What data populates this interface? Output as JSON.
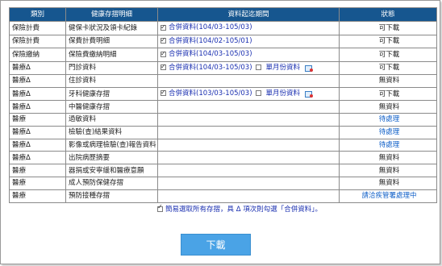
{
  "headers": {
    "category": "類別",
    "detail": "健康存摺明細",
    "period": "資料起迄期間",
    "status": "狀態"
  },
  "rows": [
    {
      "category": "保險計費",
      "detail": "健保卡狀況及領卡紀錄",
      "range": "合併資料(104/03-105/03)",
      "monthly": "",
      "status": "可下載",
      "status_link": false
    },
    {
      "category": "保險計費",
      "detail": "保費計費明細",
      "range": "合併資料(104/02-105/01)",
      "monthly": "",
      "status": "可下載",
      "status_link": false
    },
    {
      "category": "保險繳納",
      "detail": "保險費繳納明細",
      "range": "合併資料(104/03-105/03)",
      "monthly": "",
      "status": "可下載",
      "status_link": false
    },
    {
      "category": "醫療Δ",
      "detail": "門診資料",
      "range": "合併資料(104/03-105/03)",
      "monthly": "單月份資料",
      "status": "可下載",
      "status_link": false
    },
    {
      "category": "醫療Δ",
      "detail": "住診資料",
      "range": "",
      "monthly": "",
      "status": "無資料",
      "status_link": false
    },
    {
      "category": "醫療Δ",
      "detail": "牙科健康存摺",
      "range": "合併資料(103/03-105/03)",
      "monthly": "單月份資料",
      "status": "可下載",
      "status_link": false
    },
    {
      "category": "醫療Δ",
      "detail": "中醫健康存摺",
      "range": "",
      "monthly": "",
      "status": "無資料",
      "status_link": false
    },
    {
      "category": "醫療",
      "detail": "過敏資料",
      "range": "",
      "monthly": "",
      "status": "待處理",
      "status_link": true
    },
    {
      "category": "醫療Δ",
      "detail": "檢驗(查)結果資料",
      "range": "",
      "monthly": "",
      "status": "待處理",
      "status_link": true
    },
    {
      "category": "醫療Δ",
      "detail": "影像或病理檢驗(查)報告資料",
      "range": "",
      "monthly": "",
      "status": "待處理",
      "status_link": true
    },
    {
      "category": "醫療Δ",
      "detail": "出院病歷摘要",
      "range": "",
      "monthly": "",
      "status": "無資料",
      "status_link": false
    },
    {
      "category": "醫療",
      "detail": "器捐或安寧緩和醫療意願",
      "range": "",
      "monthly": "",
      "status": "無資料",
      "status_link": false
    },
    {
      "category": "醫療",
      "detail": "成人預防保健存摺",
      "range": "",
      "monthly": "",
      "status": "無資料",
      "status_link": false
    },
    {
      "category": "醫療",
      "detail": "預防接種存摺",
      "range": "",
      "monthly": "",
      "status": "請洽疾管署處理中",
      "status_link": true
    }
  ],
  "select_all_note": "簡易選取所有存摺，具 Δ 項次則勾選「合併資料」。",
  "download_label": "下載",
  "colors": {
    "header_bg": "#16568f",
    "link": "#1060c8",
    "button": "#4aa3e6"
  },
  "icons": {
    "checkbox": "checkbox-checked-icon",
    "calendar": "calendar-icon"
  }
}
